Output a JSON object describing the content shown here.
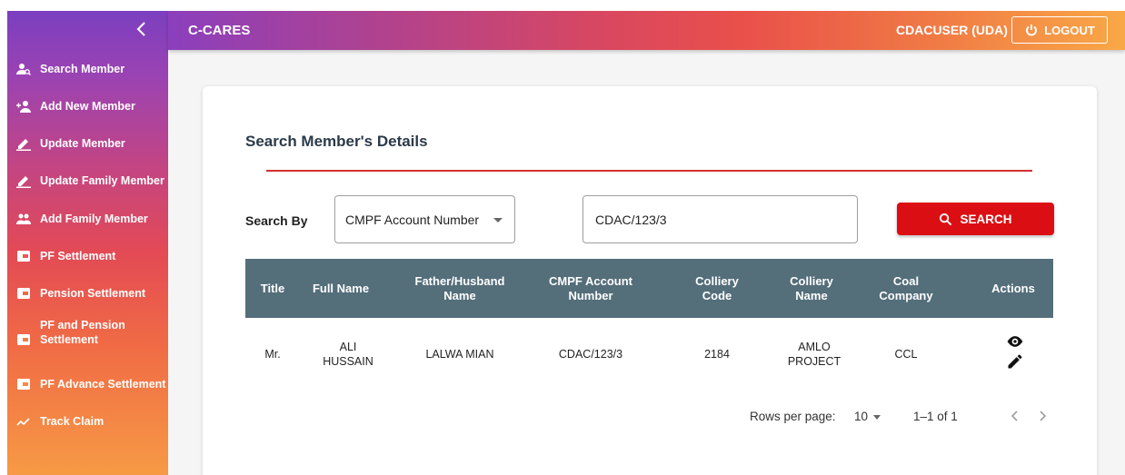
{
  "app": {
    "title": "C-CARES"
  },
  "header": {
    "user": "CDACUSER (UDA)",
    "logout_label": "LOGOUT"
  },
  "sidebar": {
    "items": [
      {
        "label": "Search Member",
        "icon": "person-search-icon"
      },
      {
        "label": "Add New Member",
        "icon": "person-add-icon"
      },
      {
        "label": "Update Member",
        "icon": "pencil-icon"
      },
      {
        "label": "Update Family Member",
        "icon": "pencil-icon"
      },
      {
        "label": "Add Family Member",
        "icon": "group-icon"
      },
      {
        "label": "PF Settlement",
        "icon": "wallet-icon"
      },
      {
        "label": "Pension Settlement",
        "icon": "wallet-icon"
      },
      {
        "label": "PF and Pension Settlement",
        "icon": "wallet-icon"
      },
      {
        "label": "PF Advance Settlement",
        "icon": "wallet-icon"
      },
      {
        "label": "Track Claim",
        "icon": "trend-icon"
      }
    ]
  },
  "search": {
    "title": "Search Member's Details",
    "search_by_label": "Search By",
    "search_by_value": "CMPF Account Number",
    "query_value": "CDAC/123/3",
    "button_label": "SEARCH"
  },
  "table": {
    "columns": [
      "Title",
      "Full Name",
      "Father/Husband Name",
      "CMPF Account Number",
      "Colliery Code",
      "Colliery Name",
      "Coal Company",
      "Actions"
    ],
    "rows": [
      {
        "title": "Mr.",
        "full_name": "ALI HUSSAIN",
        "father_name": "LALWA MIAN",
        "cmpf": "CDAC/123/3",
        "colliery_code": "2184",
        "colliery_name": "AMLO PROJECT",
        "coal_company": "CCL"
      }
    ]
  },
  "pagination": {
    "rows_per_page_label": "Rows per page:",
    "rows_per_page": "10",
    "range": "1–1 of 1"
  },
  "colors": {
    "accent_red": "#db0f13",
    "table_header": "#546e7a",
    "rule": "#d32f2f"
  }
}
